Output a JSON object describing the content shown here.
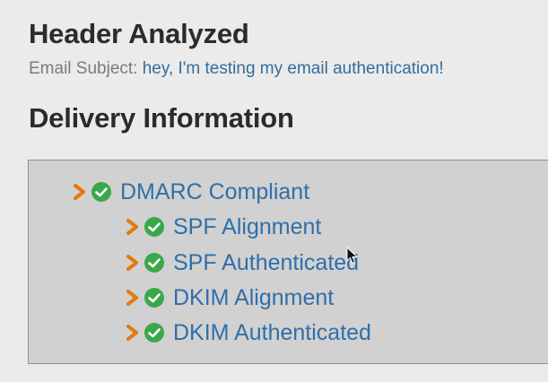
{
  "header": {
    "title": "Header Analyzed",
    "subject_label": "Email Subject:",
    "subject_value": "hey, I'm testing my email authentication!"
  },
  "delivery": {
    "title": "Delivery Information",
    "items": [
      {
        "label": "DMARC Compliant",
        "level": 0,
        "status": "pass"
      },
      {
        "label": "SPF Alignment",
        "level": 1,
        "status": "pass"
      },
      {
        "label": "SPF Authenticated",
        "level": 1,
        "status": "pass"
      },
      {
        "label": "DKIM Alignment",
        "level": 1,
        "status": "pass"
      },
      {
        "label": "DKIM Authenticated",
        "level": 1,
        "status": "pass"
      }
    ]
  },
  "icons": {
    "expand": "chevron-right-icon",
    "pass": "check-circle-icon"
  },
  "colors": {
    "background": "#ebebeb",
    "box_background": "#d1d1d1",
    "link": "#2f6fa8",
    "chevron": "#e07a10",
    "check": "#3aa84a"
  }
}
